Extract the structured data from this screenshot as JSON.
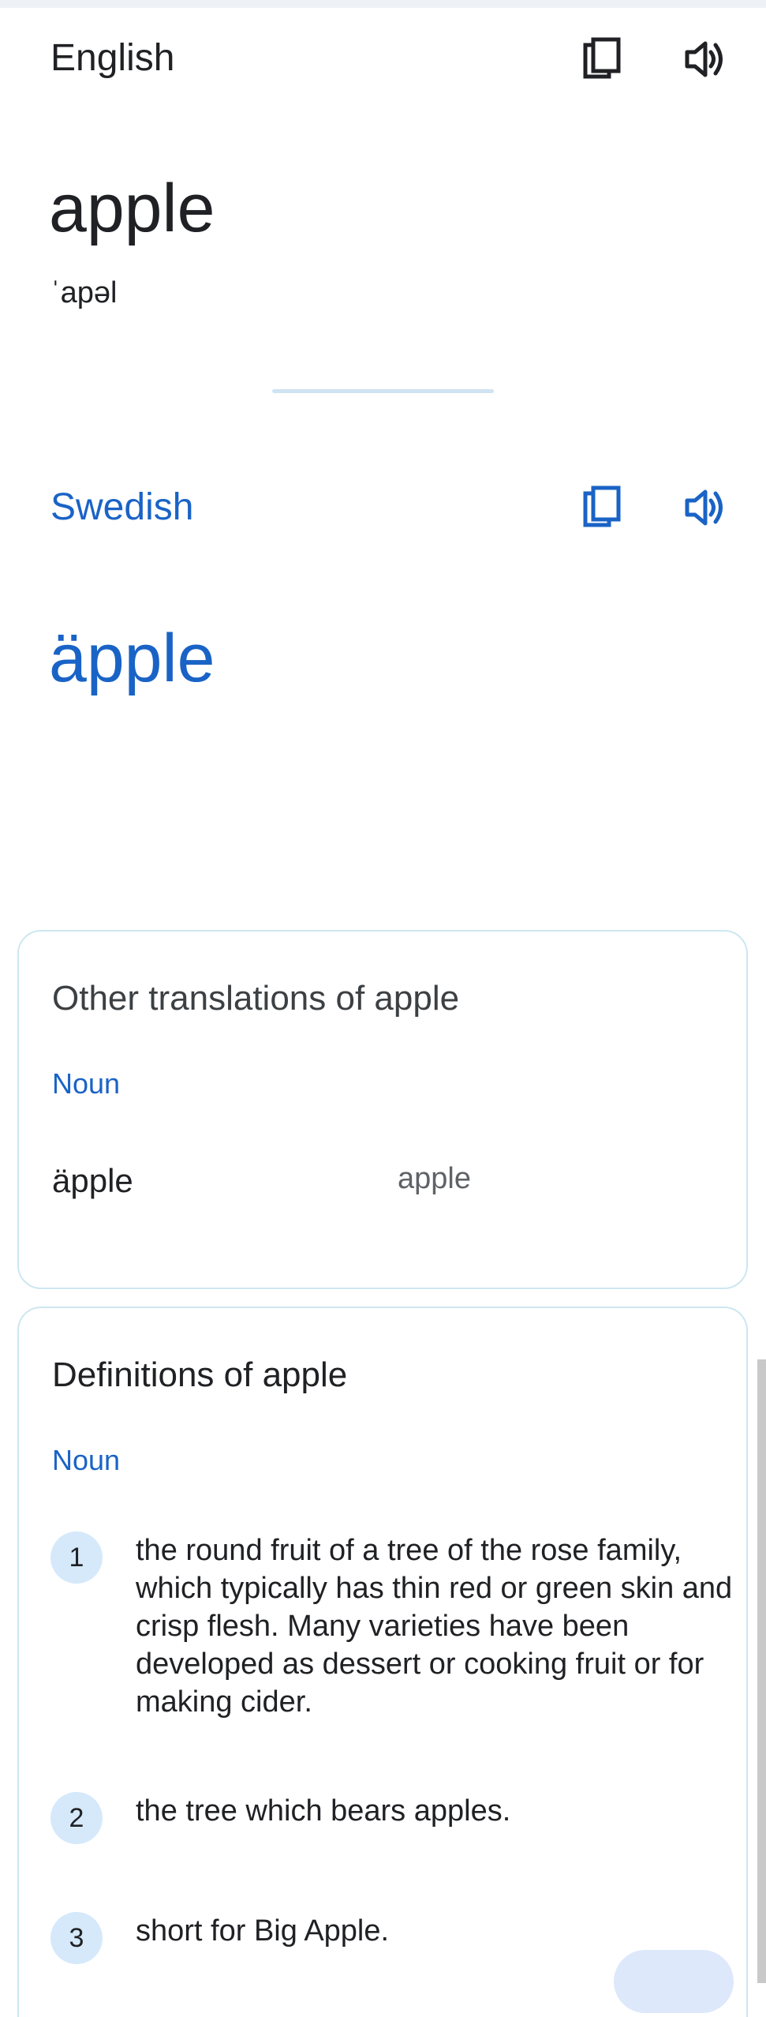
{
  "source": {
    "language": "English",
    "word": "apple",
    "phonetic": "ˈapəl",
    "copy_icon": "copy-icon",
    "speak_icon": "speaker-icon"
  },
  "target": {
    "language": "Swedish",
    "word": "äpple",
    "copy_icon": "copy-icon",
    "speak_icon": "speaker-icon"
  },
  "other_translations": {
    "title": "Other translations of apple",
    "part_of_speech": "Noun",
    "items": [
      {
        "word": "äpple",
        "back_translation": "apple"
      }
    ]
  },
  "definitions": {
    "title": "Definitions of apple",
    "part_of_speech": "Noun",
    "items": [
      {
        "number": "1",
        "text": "the round fruit of a tree of the rose family, which typically has thin red or green skin and crisp flesh. Many varieties have been developed as dessert or cooking fruit or for making cider."
      },
      {
        "number": "2",
        "text": "the tree which bears apples."
      },
      {
        "number": "3",
        "text": "short for Big Apple."
      }
    ]
  },
  "colors": {
    "accent": "#1a63c6",
    "card_border": "#cde7f0",
    "number_badge": "#d5e9fb"
  }
}
